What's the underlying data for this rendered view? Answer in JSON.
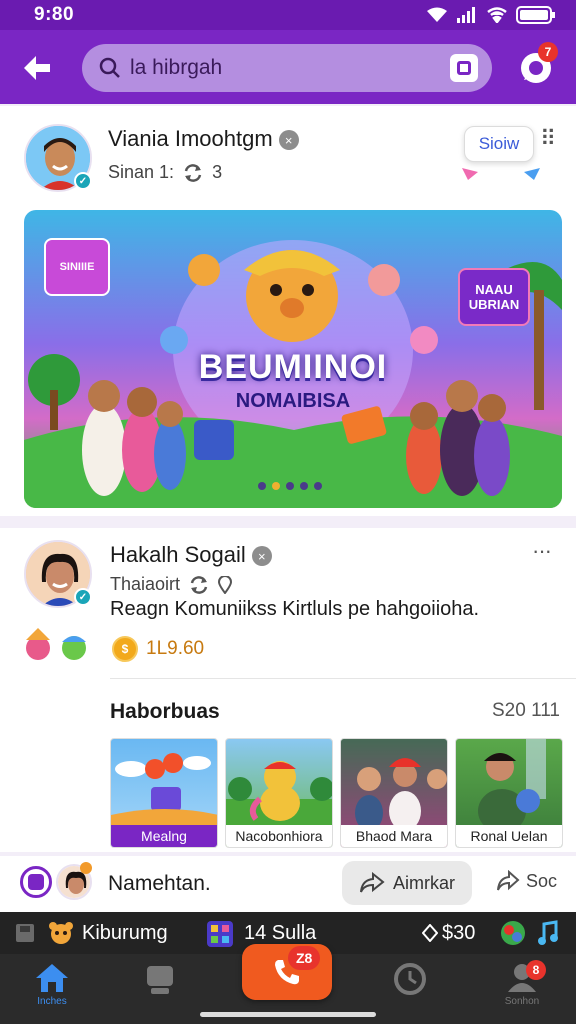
{
  "status_bar": {
    "time": "9:80"
  },
  "header": {
    "search_placeholder": "la hibrgah",
    "chat_badge": "7"
  },
  "post1": {
    "author": "Viania Imoohtgm",
    "meta_name": "Sinan 1:",
    "meta_count": "3",
    "follow_label": "Sioiw",
    "banner": {
      "title": "BEUMIINOI",
      "subtitle": "NOMAIBISA",
      "sign_left": "SINIIIE",
      "sign_right": "NAAU UBRIAN"
    }
  },
  "post2": {
    "author": "Hakalh Sogail",
    "meta_name": "Thaiaoirt",
    "body": "Reagn Komuniikss Kirtluls pe hahgoiioha.",
    "coins": "1L9.60",
    "section_title": "Haborbuas",
    "section_count": "S20 111",
    "thumbnails": [
      {
        "caption": "Mealng"
      },
      {
        "caption": "Nacobonhiora"
      },
      {
        "caption": "Bhaod Mara"
      },
      {
        "caption": "Ronal Uelan"
      }
    ]
  },
  "comment_bar": {
    "text": "Namehtan.",
    "share_label": "Aimrkar",
    "sock_label": "Soc"
  },
  "ticker": {
    "left_label": "Kiburumg",
    "mid_label": "14 Sulla",
    "amount": "$30"
  },
  "bottom_nav": {
    "home_label": "Inches",
    "live_badge": "Z8",
    "profile_badge": "8",
    "profile_label": "Sonhon"
  }
}
